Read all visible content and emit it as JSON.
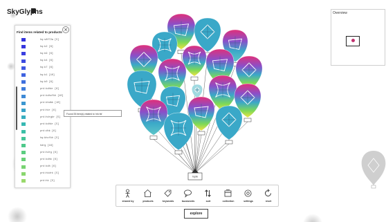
{
  "app": {
    "title": "SkyGlyphs"
  },
  "panel": {
    "title": "Find items related to products",
    "close_icon": "close-icon",
    "items": [
      {
        "label": "hq:v8f72a [5]",
        "color": "#3333dd"
      },
      {
        "label": "hq:k2 [6]",
        "color": "#3636de"
      },
      {
        "label": "hq:k9 [6]",
        "color": "#3a3fe0"
      },
      {
        "label": "hq:k4 [6]",
        "color": "#3d4be0"
      },
      {
        "label": "hq:k7 [6]",
        "color": "#3f58e1"
      },
      {
        "label": "hq:k1 [10]",
        "color": "#3f63e0"
      },
      {
        "label": "hq:k0 [6]",
        "color": "#3f70de"
      },
      {
        "label": "prd:kdhkr [6]",
        "color": "#3f7ddb"
      },
      {
        "label": "prd:kdhcfkh [10]",
        "color": "#3e8ad6"
      },
      {
        "label": "prd:khdbk [10]",
        "color": "#3c97d0"
      },
      {
        "label": "prd:hkr [6]",
        "color": "#39a3c8"
      },
      {
        "label": "prd:hdrgkr [5]",
        "color": "#37aebf"
      },
      {
        "label": "prd:kdhkr [5]",
        "color": "#37b8b3"
      },
      {
        "label": "prd:dhk [6]",
        "color": "#3bbfa6"
      },
      {
        "label": "hq:khcfkh [5]",
        "color": "#43c598"
      },
      {
        "label": "hdrg [16]",
        "color": "#4ec98b"
      },
      {
        "label": "prd:hdrg [6]",
        "color": "#5bcd80"
      },
      {
        "label": "prd:kdhk [6]",
        "color": "#69d078"
      },
      {
        "label": "prd:kdh [6]",
        "color": "#78d372"
      },
      {
        "label": "prd:hkdrk [5]",
        "color": "#89d66e"
      },
      {
        "label": "prd:hk [5]",
        "color": "#9ad96c"
      }
    ]
  },
  "tooltip": {
    "text": "Found 35 item(s) related to 'mk:hk'"
  },
  "overview": {
    "title": "Overview"
  },
  "toolbar": {
    "tools": [
      {
        "label": "shared by",
        "icon": "person-icon"
      },
      {
        "label": "products",
        "icon": "home-icon"
      },
      {
        "label": "keywords",
        "icon": "tag-icon"
      },
      {
        "label": "buzzwords",
        "icon": "speech-bubble-icon"
      },
      {
        "label": "sort",
        "icon": "sort-icon"
      },
      {
        "label": "collection",
        "icon": "collection-icon"
      },
      {
        "label": "settings",
        "icon": "gear-icon"
      },
      {
        "label": "reset",
        "icon": "reset-icon"
      }
    ]
  },
  "explore_button": {
    "label": "explore"
  },
  "anchor": {
    "label": "hq:kk"
  },
  "colors": {
    "balloon_blue": "#3aa8c8",
    "balloon_pink": "#e0307a",
    "balloon_purple": "#8a4fc9",
    "balloon_green": "#7ed957",
    "balloon_yellow": "#f2e341"
  }
}
